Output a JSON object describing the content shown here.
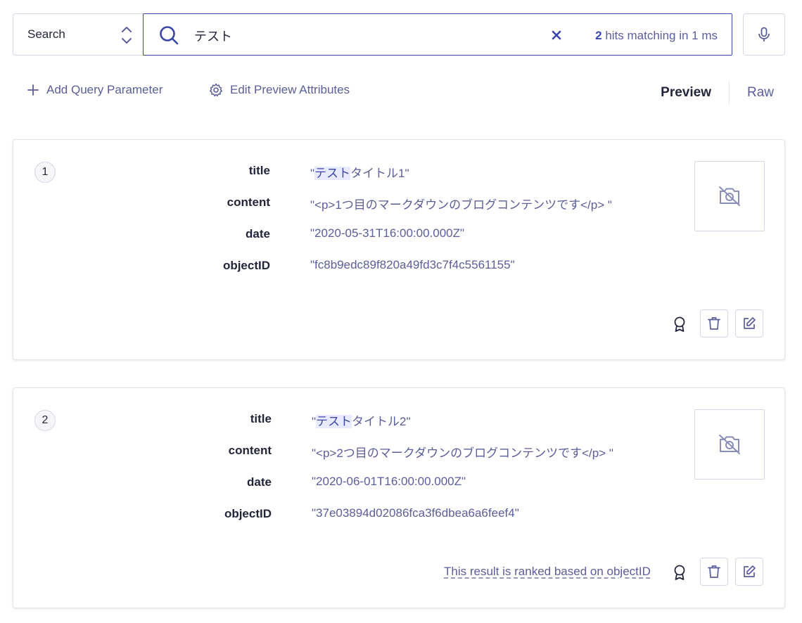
{
  "search": {
    "mode": "Search",
    "query": "テスト",
    "hits_count": "2",
    "hits_text": " hits matching in 1 ms"
  },
  "toolbar": {
    "add_param": "Add Query Parameter",
    "edit_preview": "Edit Preview Attributes",
    "tab_preview": "Preview",
    "tab_raw": "Raw"
  },
  "colors": {
    "accent": "#3a46a8",
    "text": "#23263b",
    "muted": "#5a5e9a",
    "highlight_bg": "#e8eaff"
  },
  "results": [
    {
      "rank": "1",
      "title_key": "title",
      "title_quote_open": "\"",
      "title_hl": "テスト",
      "title_rest": "タイトル1\"",
      "content_key": "content",
      "content_val": "\"<p>1つ目のマークダウンのブログコンテンツです</p> \"",
      "date_key": "date",
      "date_val": "\"2020-05-31T16:00:00.000Z\"",
      "objectid_key": "objectID",
      "objectid_val": "\"fc8b9edc89f820a49fd3c7f4c5561155\""
    },
    {
      "rank": "2",
      "title_key": "title",
      "title_quote_open": "\"",
      "title_hl": "テスト",
      "title_rest": "タイトル2\"",
      "content_key": "content",
      "content_val": "\"<p>2つ目のマークダウンのブログコンテンツです</p> \"",
      "date_key": "date",
      "date_val": "\"2020-06-01T16:00:00.000Z\"",
      "objectid_key": "objectID",
      "objectid_val": "\"37e03894d02086fca3f6dbea6a6feef4\"",
      "ranked_note": "This result is ranked based on objectID"
    }
  ]
}
